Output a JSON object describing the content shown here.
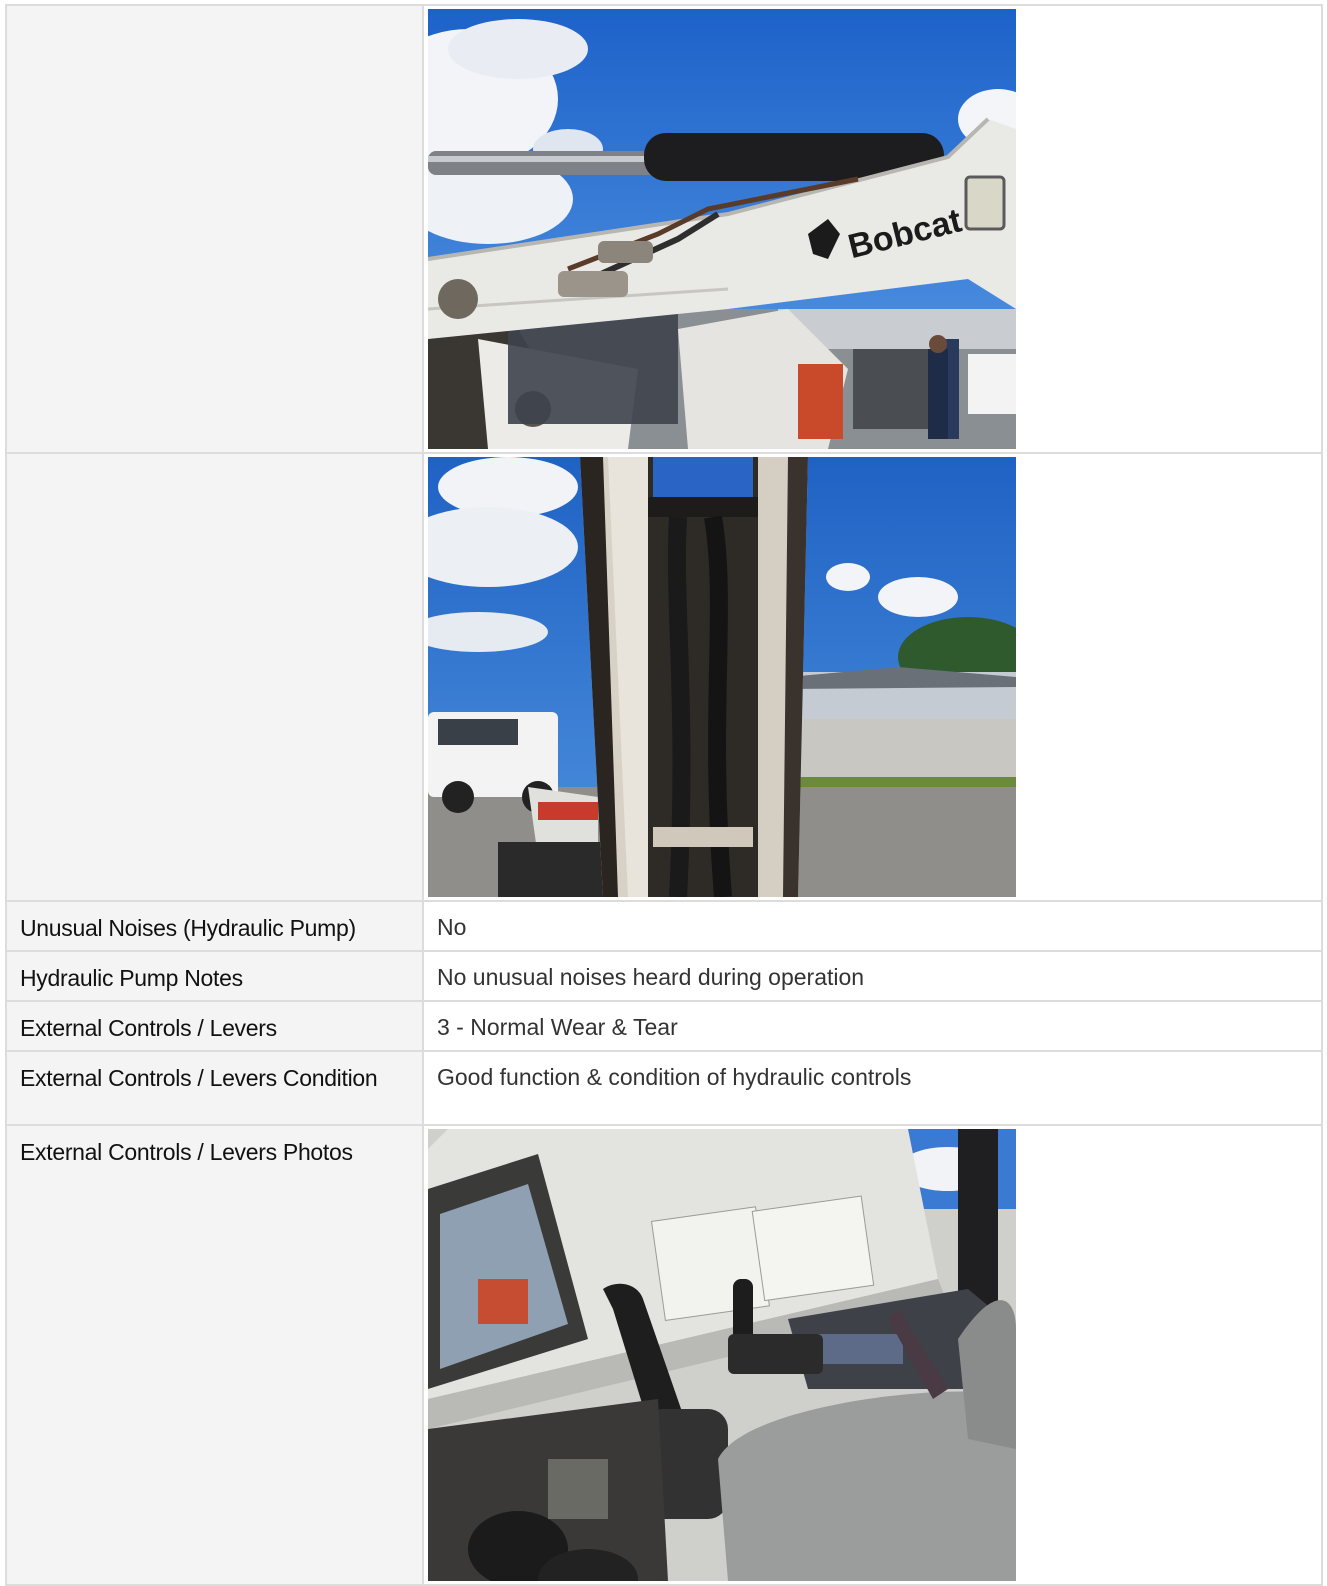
{
  "rows": {
    "unusual_noises": {
      "label": "Unusual Noises (Hydraulic Pump)",
      "value": "No"
    },
    "hydraulic_notes": {
      "label": "Hydraulic Pump Notes",
      "value": "No unusual noises heard during operation"
    },
    "controls": {
      "label": "External Controls / Levers",
      "value": "3 - Normal Wear & Tear"
    },
    "controls_condition": {
      "label": "External Controls / Levers Condition",
      "value": "Good function & condition of hydraulic controls"
    },
    "controls_photos": {
      "label": "External Controls / Levers Photos"
    }
  },
  "photos": {
    "arm_logo": "Bobcat"
  },
  "colors": {
    "sky": "#2f78d6",
    "machine_white": "#e9e9e6",
    "border": "#dcdcdc",
    "label_bg": "#f4f4f4"
  }
}
